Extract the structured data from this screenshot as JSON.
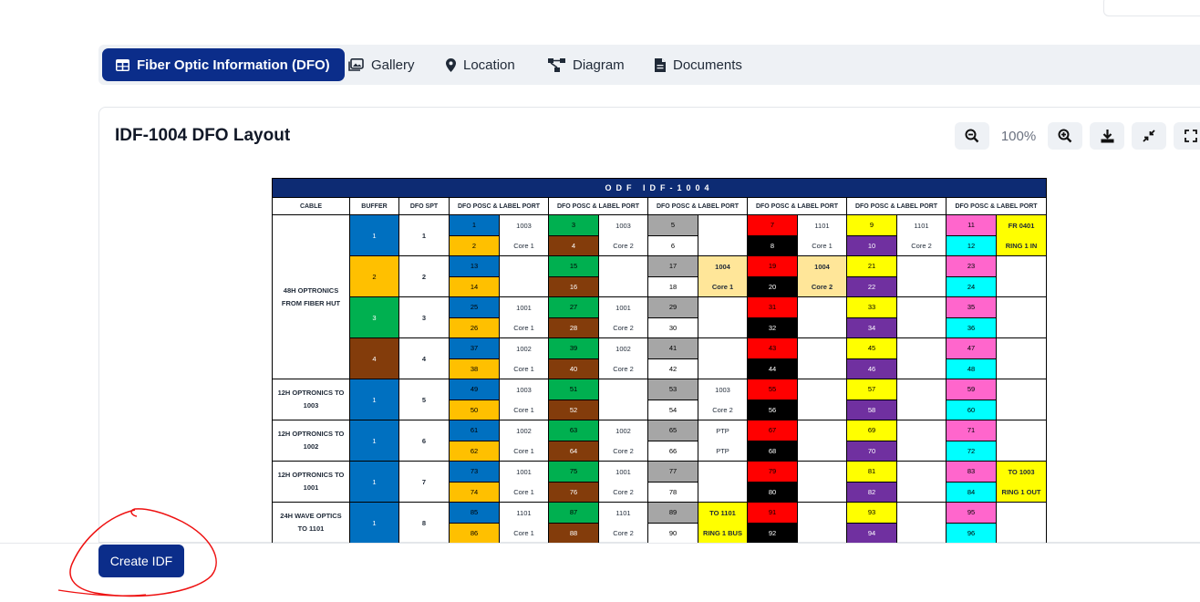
{
  "tabs": [
    {
      "label": "Fiber Optic Information (DFO)",
      "icon": "table-icon",
      "active": true
    },
    {
      "label": "Gallery",
      "icon": "gallery-icon",
      "active": false
    },
    {
      "label": "Location",
      "icon": "map-pin-icon",
      "active": false
    },
    {
      "label": "Diagram",
      "icon": "diagram-icon",
      "active": false
    },
    {
      "label": "Documents",
      "icon": "document-icon",
      "active": false
    }
  ],
  "layout_title": "IDF-1004 DFO Layout",
  "toolbar": {
    "zoom_level": "100%",
    "icons": [
      "zoom-out-icon",
      "zoom-in-icon",
      "download-icon",
      "collapse-icon",
      "fullscreen-icon"
    ]
  },
  "sheet": {
    "title": "ODF IDF-1004",
    "headers": [
      "CABLE",
      "BUFFER",
      "DFO SPT",
      "DFO POSC & LABEL PORT",
      "DFO POSC & LABEL PORT",
      "DFO POSC & LABEL PORT",
      "DFO POSC & LABEL PORT",
      "DFO POSC & LABEL PORT",
      "DFO POSC & LABEL PORT"
    ],
    "colors": {
      "blue": "#0070c0",
      "orange": "#ffc000",
      "green": "#00b050",
      "brown": "#833c0b",
      "gray": "#a6a6a6",
      "white": "#ffffff",
      "red": "#ff0000",
      "black": "#000000",
      "yellow": "#ffff00",
      "purple": "#7030a0",
      "pink": "#ff66cc",
      "cyan": "#00ffff",
      "lightorange": "#ffe699"
    },
    "cables": [
      {
        "label": "48H OPTRONICS FROM FIBER HUT",
        "span": 4
      },
      {
        "label": "12H OPTRONICS TO 1003",
        "span": 1
      },
      {
        "label": "12H OPTRONICS TO 1002",
        "span": 1
      },
      {
        "label": "12H OPTRONICS TO 1001",
        "span": 1
      },
      {
        "label": "24H WAVE OPTICS TO 1101",
        "span": 1
      }
    ],
    "buffers": [
      {
        "value": "1",
        "color": "blue"
      },
      {
        "value": "2",
        "color": "orange"
      },
      {
        "value": "3",
        "color": "green"
      },
      {
        "value": "4",
        "color": "brown"
      },
      {
        "value": "1",
        "color": "blue"
      },
      {
        "value": "1",
        "color": "blue"
      },
      {
        "value": "1",
        "color": "blue"
      },
      {
        "value": "1",
        "color": "blue"
      }
    ],
    "spt": [
      "1",
      "2",
      "3",
      "4",
      "5",
      "6",
      "7",
      "8"
    ],
    "groups": [
      {
        "colors": [
          "blue",
          "orange"
        ],
        "ports": [
          [
            "1",
            "2"
          ],
          [
            "13",
            "14"
          ],
          [
            "25",
            "26"
          ],
          [
            "37",
            "38"
          ],
          [
            "49",
            "50"
          ],
          [
            "61",
            "62"
          ],
          [
            "73",
            "74"
          ],
          [
            "85",
            "86"
          ]
        ],
        "labels": [
          [
            "1003",
            "Core 1"
          ],
          [
            "",
            ""
          ],
          [
            "1001",
            "Core 1"
          ],
          [
            "1002",
            "Core 1"
          ],
          [
            "1003",
            "Core 1"
          ],
          [
            "1002",
            "Core 1"
          ],
          [
            "1001",
            "Core 1"
          ],
          [
            "1101",
            "Core 1"
          ]
        ]
      },
      {
        "colors": [
          "green",
          "brown"
        ],
        "ports": [
          [
            "3",
            "4"
          ],
          [
            "15",
            "16"
          ],
          [
            "27",
            "28"
          ],
          [
            "39",
            "40"
          ],
          [
            "51",
            "52"
          ],
          [
            "63",
            "64"
          ],
          [
            "75",
            "76"
          ],
          [
            "87",
            "88"
          ]
        ],
        "labels": [
          [
            "1003",
            "Core 2"
          ],
          [
            "",
            ""
          ],
          [
            "1001",
            "Core 2"
          ],
          [
            "1002",
            "Core 2"
          ],
          [
            "",
            ""
          ],
          [
            "1002",
            "Core 2"
          ],
          [
            "1001",
            "Core 2"
          ],
          [
            "1101",
            "Core 2"
          ]
        ]
      },
      {
        "colors": [
          "gray",
          "white"
        ],
        "ports": [
          [
            "5",
            "6"
          ],
          [
            "17",
            "18"
          ],
          [
            "29",
            "30"
          ],
          [
            "41",
            "42"
          ],
          [
            "53",
            "54"
          ],
          [
            "65",
            "66"
          ],
          [
            "77",
            "78"
          ],
          [
            "89",
            "90"
          ]
        ],
        "labels": [
          [
            "",
            ""
          ],
          [
            "1004",
            "Core 1"
          ],
          [
            "",
            ""
          ],
          [
            "",
            ""
          ],
          [
            "1003",
            "Core 2"
          ],
          [
            "PTP",
            "PTP"
          ],
          [
            "",
            ""
          ],
          [
            "TO 1101",
            "RING 1 BUS"
          ]
        ]
      },
      {
        "colors": [
          "red",
          "black"
        ],
        "ports": [
          [
            "7",
            "8"
          ],
          [
            "19",
            "20"
          ],
          [
            "31",
            "32"
          ],
          [
            "43",
            "44"
          ],
          [
            "55",
            "56"
          ],
          [
            "67",
            "68"
          ],
          [
            "79",
            "80"
          ],
          [
            "91",
            "92"
          ]
        ],
        "labels": [
          [
            "1101",
            "Core 1"
          ],
          [
            "1004",
            "Core 2"
          ],
          [
            "",
            ""
          ],
          [
            "",
            ""
          ],
          [
            "",
            ""
          ],
          [
            "",
            ""
          ],
          [
            "",
            ""
          ],
          [
            "",
            ""
          ]
        ]
      },
      {
        "colors": [
          "yellow",
          "purple"
        ],
        "ports": [
          [
            "9",
            "10"
          ],
          [
            "21",
            "22"
          ],
          [
            "33",
            "34"
          ],
          [
            "45",
            "46"
          ],
          [
            "57",
            "58"
          ],
          [
            "69",
            "70"
          ],
          [
            "81",
            "82"
          ],
          [
            "93",
            "94"
          ]
        ],
        "labels": [
          [
            "1101",
            "Core 2"
          ],
          [
            "",
            ""
          ],
          [
            "",
            ""
          ],
          [
            "",
            ""
          ],
          [
            "",
            ""
          ],
          [
            "",
            ""
          ],
          [
            "",
            ""
          ],
          [
            "",
            ""
          ]
        ]
      },
      {
        "colors": [
          "pink",
          "cyan"
        ],
        "ports": [
          [
            "11",
            "12"
          ],
          [
            "23",
            "24"
          ],
          [
            "35",
            "36"
          ],
          [
            "47",
            "48"
          ],
          [
            "59",
            "60"
          ],
          [
            "71",
            "72"
          ],
          [
            "83",
            "84"
          ],
          [
            "95",
            "96"
          ]
        ],
        "labels": [
          [
            "FR 0401",
            "RING 1 IN"
          ],
          [
            "",
            ""
          ],
          [
            "",
            ""
          ],
          [
            "",
            ""
          ],
          [
            "",
            ""
          ],
          [
            "",
            ""
          ],
          [
            "TO 1003",
            "RING 1 OUT"
          ],
          [
            "",
            ""
          ]
        ]
      }
    ]
  },
  "create_button": "Create IDF"
}
